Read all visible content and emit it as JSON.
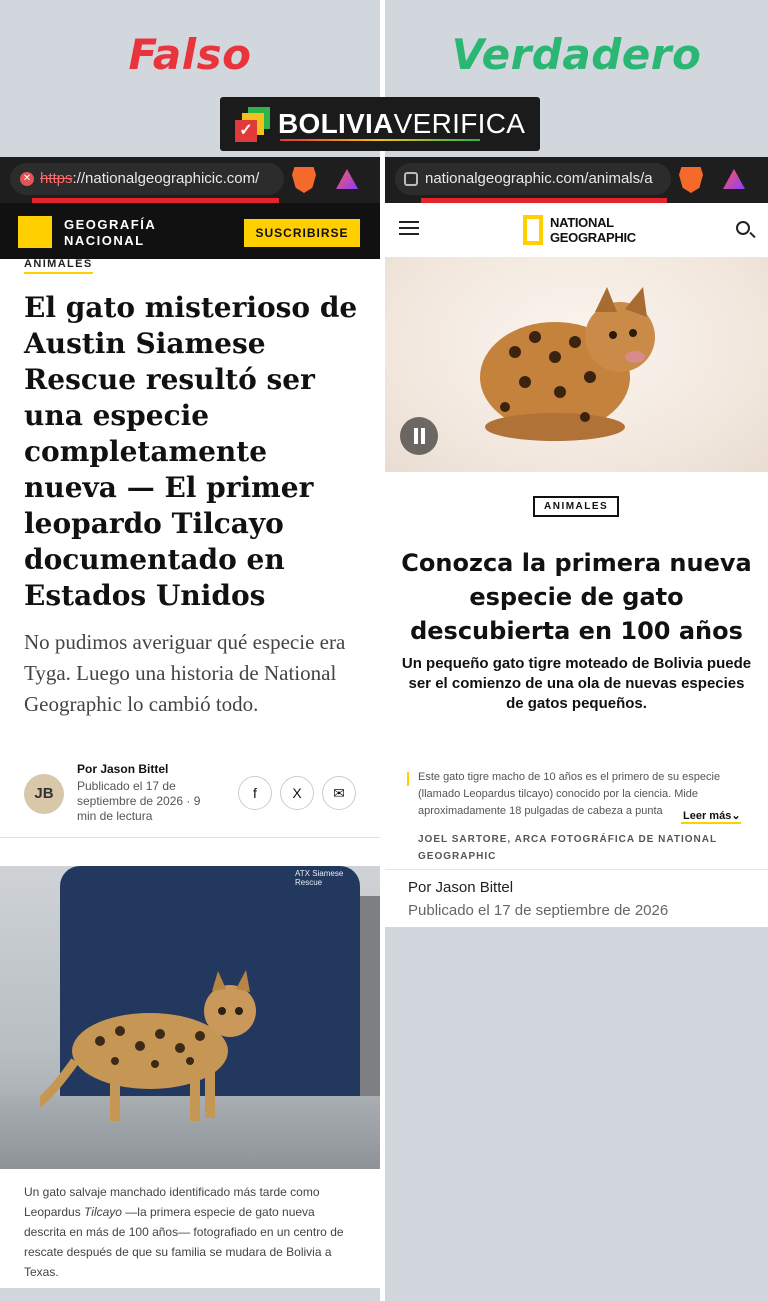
{
  "labels": {
    "false": "Falso",
    "true": "Verdadero"
  },
  "brand": {
    "bold": "BOLIVIA",
    "light": "VERIFICA",
    "check": "✓"
  },
  "left": {
    "url_scheme": "https",
    "url_rest": "://nationalgeographicic.com/",
    "header_brand_line1": "GEOGRAFÍA",
    "header_brand_line2": "NACIONAL",
    "subscribe": "SUSCRIBIRSE",
    "section": "ANIMALES",
    "headline": "El gato misterioso de Austin Siamese Rescue resultó ser una especie completamente nueva — El primer leopardo Tilcayo documentado en Estados Unidos",
    "dek": "No pudimos averiguar qué especie era Tyga. Luego una historia de National Geographic lo cambió todo.",
    "author_initials": "JB",
    "author": "Por Jason Bittel",
    "published": "Publicado el 17 de septiembre de 2026 · 9 min de lectura",
    "share": {
      "facebook": "f",
      "x": "X",
      "email": "✉"
    },
    "scrub_label": "ATX Siamese Rescue",
    "caption_a": "Un gato salvaje manchado identificado más tarde como Leopardus ",
    "caption_italic": "Tilcayo",
    "caption_b": " —la primera especie de gato nueva descrita en más de 100 años— fotografiado en un centro de rescate después de que su familia se mudara de Bolivia a Texas."
  },
  "right": {
    "url": "nationalgeographic.com/animals/a",
    "logo_line1": "NATIONAL",
    "logo_line2": "GEOGRAPHIC",
    "section": "ANIMALES",
    "headline": "Conozca la primera nueva especie de gato descubierta en 100 años",
    "dek": "Un pequeño gato tigre moteado de Bolivia puede ser el comienzo de una ola de nuevas especies de gatos pequeños.",
    "caption": "Este gato tigre macho de 10 años es el primero de su especie (llamado Leopardus tilcayo) conocido por la ciencia. Mide aproximadamente 18 pulgadas de cabeza a punta",
    "read_more": "Leer más",
    "credit": "JOEL SARTORE, ARCA FOTOGRÁFICA DE NATIONAL GEOGRAPHIC",
    "author": "Por  Jason Bittel",
    "published": "Publicado el 17 de septiembre de 2026"
  },
  "colors": {
    "false": "#e8343a",
    "true": "#2ab673",
    "ng_yellow": "#ffcf00",
    "alert_red": "#e3242b"
  }
}
